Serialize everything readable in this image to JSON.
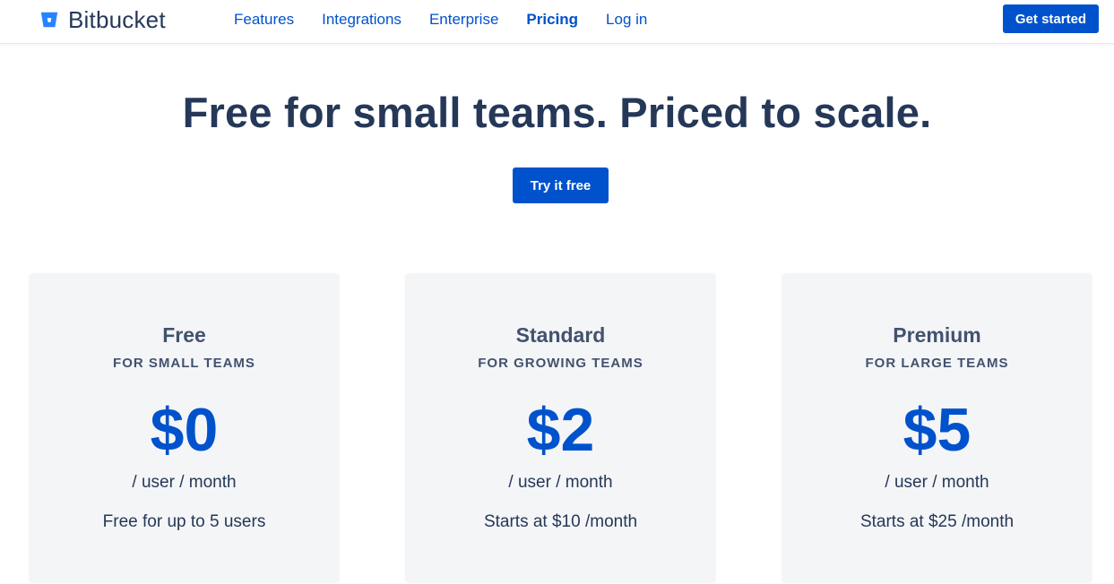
{
  "brand": {
    "name": "Bitbucket",
    "logo_icon": "bitbucket-bucket-icon",
    "color": "#2684ff"
  },
  "nav": {
    "links": [
      {
        "label": "Features",
        "active": false
      },
      {
        "label": "Integrations",
        "active": false
      },
      {
        "label": "Enterprise",
        "active": false
      },
      {
        "label": "Pricing",
        "active": true
      },
      {
        "label": "Log in",
        "active": false
      }
    ],
    "cta_label": "Get started"
  },
  "hero": {
    "title": "Free for small teams. Priced to scale.",
    "cta_label": "Try it free"
  },
  "plans": [
    {
      "name": "Free",
      "subtitle": "FOR SMALL TEAMS",
      "price": "$0",
      "unit": "/ user / month",
      "note": "Free for up to 5 users"
    },
    {
      "name": "Standard",
      "subtitle": "FOR GROWING TEAMS",
      "price": "$2",
      "unit": "/ user / month",
      "note": "Starts at $10 /month"
    },
    {
      "name": "Premium",
      "subtitle": "FOR LARGE TEAMS",
      "price": "$5",
      "unit": "/ user / month",
      "note": "Starts at $25 /month"
    }
  ],
  "colors": {
    "primary": "#0052cc",
    "heading": "#253858",
    "muted": "#42526e",
    "card_bg": "#f4f5f7"
  }
}
